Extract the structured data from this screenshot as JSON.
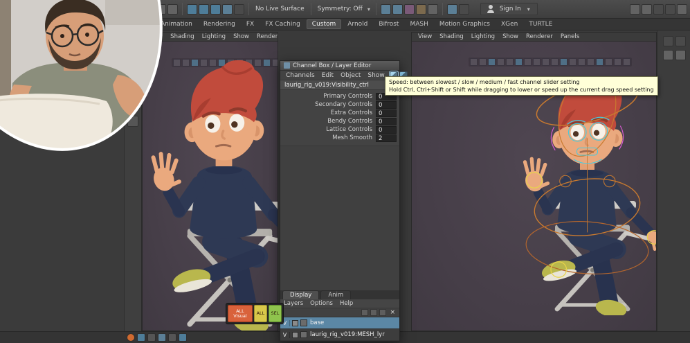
{
  "colors": {
    "viewport_bg": "#48404a",
    "ui_bg": "#3c3c3c",
    "selection_blue": "#5b87a5",
    "tooltip_bg": "#ffffd8",
    "button_orange": "#d9623b",
    "button_yellow": "#d8c84a",
    "button_green": "#8fc44d",
    "hair_red": "#c14b3c",
    "skin": "#eaa97e",
    "outfit_navy": "#2e3954"
  },
  "icons": {
    "caret_down": "▾",
    "close": "×"
  },
  "status_line": {
    "no_live_surface": "No Live Surface",
    "symmetry": "Symmetry: Off",
    "sign_in": "Sign In"
  },
  "shelf": {
    "active_tab": "Custom",
    "tabs": [
      "Animation",
      "Rendering",
      "FX",
      "FX Caching",
      "Custom",
      "Arnold",
      "Bifrost",
      "MASH",
      "Motion Graphics",
      "XGen",
      "TURTLE"
    ]
  },
  "viewport": {
    "menus": [
      "View",
      "Shading",
      "Lighting",
      "Show",
      "Renderer",
      "Panels"
    ]
  },
  "channel_box": {
    "title": "Channel Box / Layer Editor",
    "menus": [
      "Channels",
      "Edit",
      "Object",
      "Show"
    ],
    "object_name": "laurig_rig_v019:Visibility_ctrl",
    "attributes": [
      {
        "name": "Primary Controls",
        "value": "0"
      },
      {
        "name": "Secondary Controls",
        "value": "0"
      },
      {
        "name": "Extra Controls",
        "value": "0"
      },
      {
        "name": "Bendy Controls",
        "value": "0"
      },
      {
        "name": "Lattice Controls",
        "value": "0"
      },
      {
        "name": "Mesh Smooth",
        "value": "2"
      }
    ]
  },
  "layer_editor": {
    "tabs": [
      "Display",
      "Anim"
    ],
    "active_tab": "Display",
    "menus": [
      "Layers",
      "Options",
      "Help"
    ],
    "layers": [
      {
        "visible": "V",
        "name": "base",
        "selected": true
      },
      {
        "visible": "V",
        "name": "laurig_rig_v019:MESH_lyr",
        "selected": false
      }
    ]
  },
  "tooltip": {
    "line1": "Speed: between slowest / slow / medium / fast channel slider setting",
    "line2": "Hold Ctrl, Ctrl+Shift or Shift while dragging to lower or speed up the current drag speed setting"
  },
  "picker": {
    "buttons": [
      {
        "label": "ALL Visual"
      },
      {
        "label": "ALL"
      },
      {
        "label": "SEL"
      }
    ]
  }
}
